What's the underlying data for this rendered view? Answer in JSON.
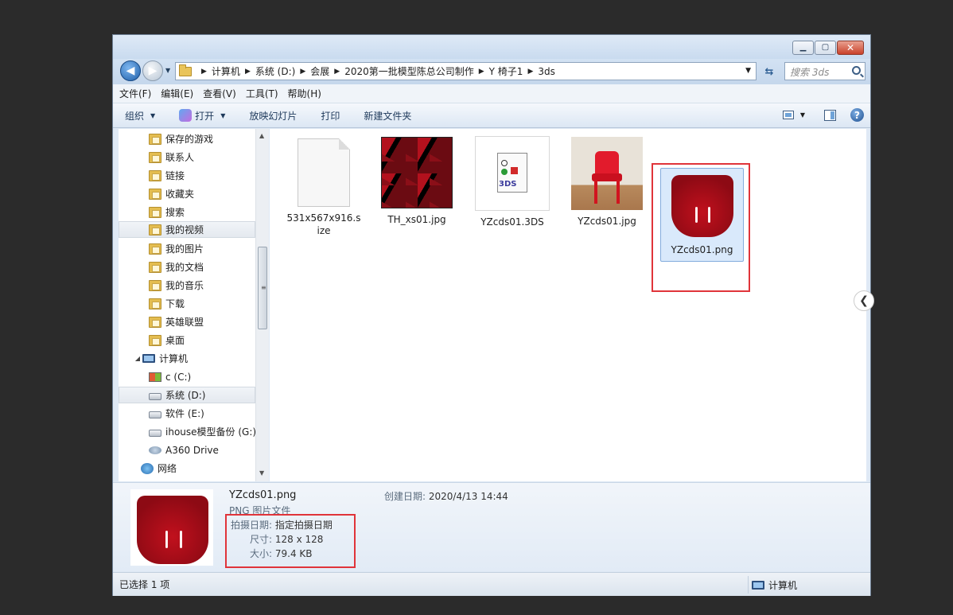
{
  "address": {
    "crumbs": [
      "计算机",
      "系统 (D:)",
      "会展",
      "2020第一批模型陈总公司制作",
      "Y 椅子1",
      "3ds"
    ]
  },
  "search": {
    "placeholder": "搜索 3ds"
  },
  "menu": [
    "文件(F)",
    "编辑(E)",
    "查看(V)",
    "工具(T)",
    "帮助(H)"
  ],
  "toolbar": {
    "organize": "组织",
    "open": "打开",
    "slideshow": "放映幻灯片",
    "print": "打印",
    "new_folder": "新建文件夹"
  },
  "nav": {
    "items": [
      {
        "label": "保存的游戏",
        "icon": "folder-icon"
      },
      {
        "label": "联系人",
        "icon": "folder-icon"
      },
      {
        "label": "链接",
        "icon": "folder-icon"
      },
      {
        "label": "收藏夹",
        "icon": "folder-icon"
      },
      {
        "label": "搜索",
        "icon": "folder-icon"
      },
      {
        "label": "我的视频",
        "icon": "folder-icon"
      },
      {
        "label": "我的图片",
        "icon": "folder-icon"
      },
      {
        "label": "我的文档",
        "icon": "folder-icon"
      },
      {
        "label": "我的音乐",
        "icon": "folder-icon"
      },
      {
        "label": "下载",
        "icon": "folder-icon"
      },
      {
        "label": "英雄联盟",
        "icon": "folder-icon"
      },
      {
        "label": "桌面",
        "icon": "folder-icon"
      },
      {
        "label": "计算机",
        "icon": "computer-icon"
      },
      {
        "label": "c (C:)",
        "icon": "windows-drive-icon"
      },
      {
        "label": "系统 (D:)",
        "icon": "drive-icon"
      },
      {
        "label": "软件 (E:)",
        "icon": "drive-icon"
      },
      {
        "label": "ihouse模型备份 (G:)",
        "icon": "drive-icon"
      },
      {
        "label": "A360 Drive",
        "icon": "cloud-drive-icon"
      },
      {
        "label": "网络",
        "icon": "network-icon"
      }
    ]
  },
  "files": [
    {
      "name": "531x567x916.size",
      "kind": "document"
    },
    {
      "name": "TH_xs01.jpg",
      "kind": "texture"
    },
    {
      "name": "YZcds01.3DS",
      "kind": "3ds"
    },
    {
      "name": "YZcds01.jpg",
      "kind": "photo"
    },
    {
      "name": "YZcds01.png",
      "kind": "seat",
      "selected": true
    }
  ],
  "details": {
    "name": "YZcds01.png",
    "type": "PNG 图片文件",
    "created_label": "创建日期:",
    "created_value": "2020/4/13 14:44",
    "taken_label": "拍摄日期:",
    "taken_value": "指定拍摄日期",
    "size_dims_label": "尺寸:",
    "size_dims_value": "128 x 128",
    "filesize_label": "大小:",
    "filesize_value": "79.4 KB"
  },
  "status": {
    "selected": "已选择 1 项",
    "location": "计算机"
  },
  "colors": {
    "highlight_box": "#e0343a",
    "selection": "#d9e9fb"
  }
}
